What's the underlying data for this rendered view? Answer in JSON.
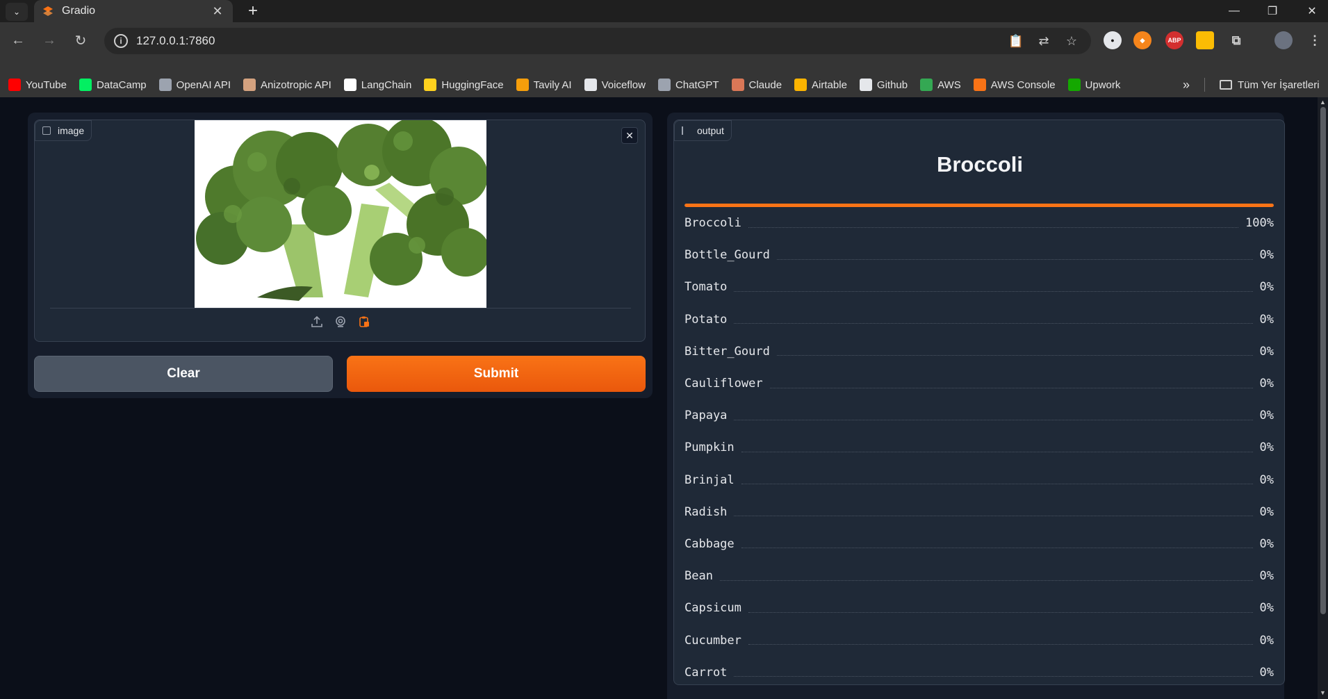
{
  "browser": {
    "tab_title": "Gradio",
    "url": "127.0.0.1:7860",
    "bookmarks": [
      {
        "label": "YouTube",
        "icon": "youtube-icon",
        "color": "#ff0000"
      },
      {
        "label": "DataCamp",
        "icon": "datacamp-icon",
        "color": "#03ef62"
      },
      {
        "label": "OpenAI API",
        "icon": "openai-icon",
        "color": "#9ca3af"
      },
      {
        "label": "Anizotropic API",
        "icon": "anthropic-icon",
        "color": "#d4a27f"
      },
      {
        "label": "LangChain",
        "icon": "langchain-icon",
        "color": "#ffffff"
      },
      {
        "label": "HuggingFace",
        "icon": "huggingface-icon",
        "color": "#ffd21e"
      },
      {
        "label": "Tavily AI",
        "icon": "tavily-icon",
        "color": "#f59e0b"
      },
      {
        "label": "Voiceflow",
        "icon": "voiceflow-icon",
        "color": "#e5e7eb"
      },
      {
        "label": "ChatGPT",
        "icon": "chatgpt-icon",
        "color": "#9ca3af"
      },
      {
        "label": "Claude",
        "icon": "claude-icon",
        "color": "#d97757"
      },
      {
        "label": "Airtable",
        "icon": "airtable-icon",
        "color": "#fcb400"
      },
      {
        "label": "Github",
        "icon": "github-icon",
        "color": "#e5e7eb"
      },
      {
        "label": "AWS",
        "icon": "google-drive-icon",
        "color": "#34a853"
      },
      {
        "label": "AWS Console",
        "icon": "aws-console-icon",
        "color": "#f97316"
      },
      {
        "label": "Upwork",
        "icon": "upwork-icon",
        "color": "#14a800"
      }
    ],
    "all_bookmarks_label": "Tüm Yer İşaretleri"
  },
  "input": {
    "label": "image"
  },
  "buttons": {
    "clear": "Clear",
    "submit": "Submit"
  },
  "output": {
    "label": "output",
    "top_label": "Broccoli",
    "top_confidence": 1.0,
    "accent_color": "#f97316",
    "confidences": [
      {
        "label": "Broccoli",
        "value": "100%"
      },
      {
        "label": "Bottle_Gourd",
        "value": "0%"
      },
      {
        "label": "Tomato",
        "value": "0%"
      },
      {
        "label": "Potato",
        "value": "0%"
      },
      {
        "label": "Bitter_Gourd",
        "value": "0%"
      },
      {
        "label": "Cauliflower",
        "value": "0%"
      },
      {
        "label": "Papaya",
        "value": "0%"
      },
      {
        "label": "Pumpkin",
        "value": "0%"
      },
      {
        "label": "Brinjal",
        "value": "0%"
      },
      {
        "label": "Radish",
        "value": "0%"
      },
      {
        "label": "Cabbage",
        "value": "0%"
      },
      {
        "label": "Bean",
        "value": "0%"
      },
      {
        "label": "Capsicum",
        "value": "0%"
      },
      {
        "label": "Cucumber",
        "value": "0%"
      },
      {
        "label": "Carrot",
        "value": "0%"
      }
    ]
  }
}
